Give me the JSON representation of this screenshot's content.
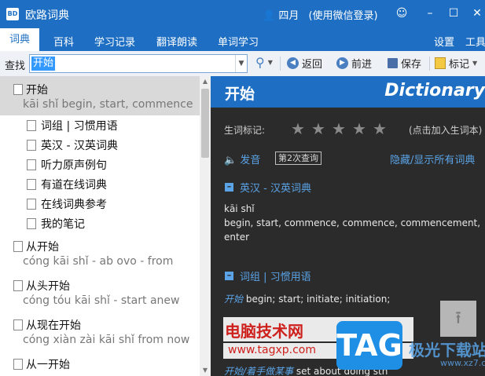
{
  "titlebar": {
    "app_logo": "BD",
    "title": "欧路词典",
    "user_icon": "user-icon",
    "user_name": "四月",
    "wechat_login": "(使用微信登录)",
    "buttons": {
      "emoji": "☺",
      "minimize": "–",
      "maximize": "☐",
      "close": "✕"
    }
  },
  "menu": {
    "items": [
      "词典",
      "百科",
      "学习记录",
      "翻译朗读",
      "单词学习"
    ],
    "settings": "设置",
    "tools": "工具"
  },
  "toolbar": {
    "search_label": "查找",
    "search_value": "开始",
    "back": "返回",
    "forward": "前进",
    "save": "保存",
    "mark": "标记"
  },
  "list": {
    "selected": {
      "word": "开始",
      "pinyin": "kāi shǐ   begin, start, commence"
    },
    "sub_items": [
      "词组 | 习惯用语",
      "英汉 - 汉英词典",
      "听力原声例句",
      "有道在线词典",
      "在线词典参考",
      "我的笔记"
    ],
    "entries": [
      {
        "word": "从开始",
        "pinyin": "cóng kāi shǐ   - ab ovo  - from"
      },
      {
        "word": "从头开始",
        "pinyin": "cóng tóu kāi shǐ   - start anew"
      },
      {
        "word": "从现在开始",
        "pinyin": "cóng xiàn zài kāi shǐ   from now"
      },
      {
        "word": "从一开始",
        "pinyin": ""
      }
    ]
  },
  "detail": {
    "word": "开始",
    "dict_brand": "Dictionary",
    "vocab_label": "生词标记:",
    "stars": 0,
    "add_hint": "(点击加入生词本)",
    "pronounce": "发音",
    "query_badge": "第2次查询",
    "toggle_all": "隐藏/显示所有词典",
    "section1_title": "英汉 - 汉英词典",
    "section1_pinyin": "kāi shǐ",
    "section1_def_line1": "begin, start, commence, commence, commencement,",
    "section1_def_line2": "enter",
    "section2_title": "词组 | 习惯用语",
    "phrase1_word": "开始",
    "phrase1_def": " begin; start; initiate; initiation;",
    "phrase2_word": "开始/着手做某事",
    "phrase2_def": " set about doing sth",
    "phrase3_def": "sth"
  },
  "watermark": {
    "site_name": "电脑技术网",
    "site_url": "www.tagxp.com",
    "tag_logo": "TAG",
    "dl_site": "极光下载站",
    "dl_url": "www.xz7.com"
  }
}
